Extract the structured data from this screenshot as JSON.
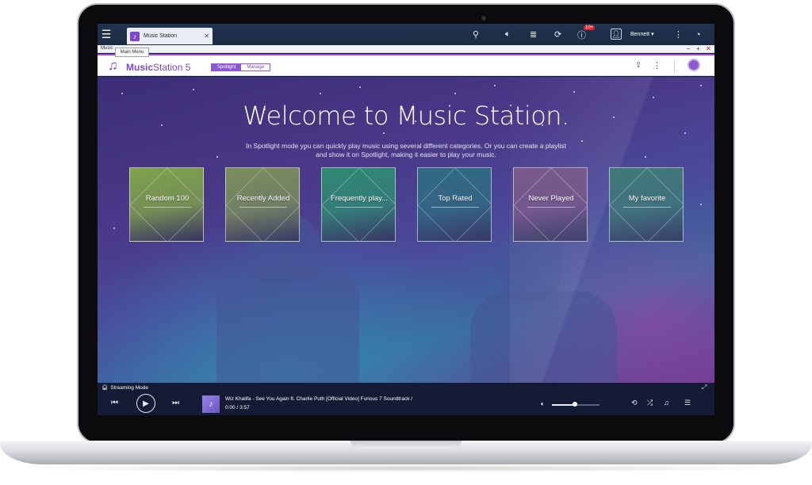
{
  "taskbar": {
    "app_tab_label": "Music Station",
    "username": "Bennett",
    "username_caret": "▾",
    "notification_badge": "10+"
  },
  "window": {
    "title": "Music",
    "tooltip": "Main Menu"
  },
  "header": {
    "logo_bold": "Music",
    "logo_rest": "Station 5",
    "tabs": [
      {
        "label": "Spotlight",
        "active": true
      },
      {
        "label": "Manage",
        "active": false
      }
    ]
  },
  "main": {
    "heading": "Welcome to Music Station.",
    "description": "In Spotlight mode you can quickly play music using several different categories. Or you can create a playlist and show it on Spotlight, making it easier to play your music.",
    "categories": [
      {
        "label": "Random 100",
        "color": "#7fa34a"
      },
      {
        "label": "Recently Added",
        "color": "#7c8e5c"
      },
      {
        "label": "Frequently play...",
        "color": "#2f8a73"
      },
      {
        "label": "Top Rated",
        "color": "#2f6b82"
      },
      {
        "label": "Never Played",
        "color": "#7a5a8a"
      },
      {
        "label": "My favorite",
        "color": "#3f7a78"
      }
    ]
  },
  "player": {
    "mode_label": "Streaming Mode",
    "track_title": "Wiz Khalifa - See You Again ft. Charlie Puth [Official Video] Furious 7 Soundtrack /",
    "time": "0:00 / 3:57",
    "volume": 0.48
  },
  "colors": {
    "accent": "#7b47c7",
    "accent_bar": "#b04ad8",
    "taskbar": "#1b2a44",
    "player_bg": "#151b35"
  }
}
